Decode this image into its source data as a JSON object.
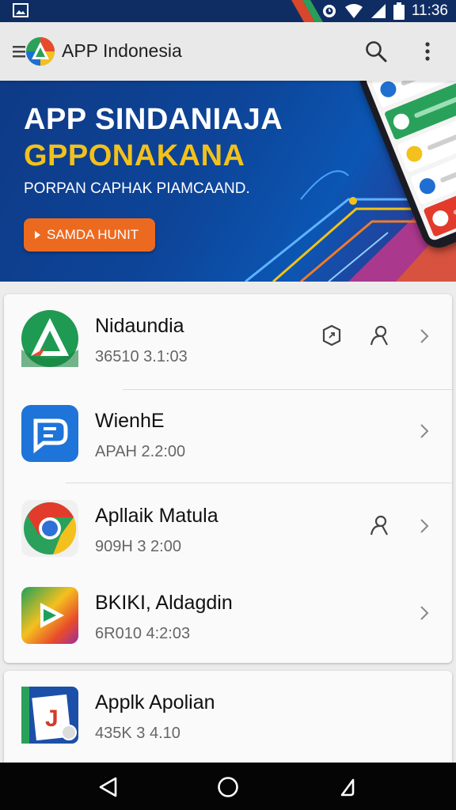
{
  "status_bar": {
    "time": "11:36",
    "icons": [
      "image-icon",
      "alarm-icon",
      "wifi-icon",
      "signal-icon",
      "battery-icon"
    ]
  },
  "app_bar": {
    "title": "APP Indonesia",
    "icons": [
      "menu-icon",
      "app-logo-icon",
      "search-icon",
      "more-vert-icon"
    ]
  },
  "banner": {
    "headline_1": "APP SINDANIAJA",
    "headline_2": "GPPONAKANA",
    "subtitle": "PORPAN CAPHAK PIAMCAAND.",
    "cta_label": "SAMDA HUNIT",
    "colors": {
      "headline_2": "#f3c11a",
      "cta": "#ec6a1f"
    }
  },
  "apps": [
    {
      "name": "Nidaundia",
      "meta": "36510 3.1:03",
      "icon": "green-triangle-app-icon",
      "actions": [
        "share-icon",
        "person-icon"
      ]
    },
    {
      "name": "WienhE",
      "meta": "APAH 2.2:00",
      "icon": "blue-chat-app-icon",
      "actions": []
    },
    {
      "name": "Apllaik Matula",
      "meta": "909H 3 2:00",
      "icon": "chrome-app-icon",
      "actions": [
        "person-icon"
      ]
    },
    {
      "name": "BKIKI, Aldagdin",
      "meta": "6R010 4:2:03",
      "icon": "play-store-app-icon",
      "actions": []
    },
    {
      "name": "Applk Apolian",
      "meta": "435K 3 4.10",
      "icon": "book-app-icon",
      "actions": []
    }
  ],
  "nav_bar": {
    "icons": [
      "back-icon",
      "home-icon",
      "recents-icon"
    ]
  }
}
